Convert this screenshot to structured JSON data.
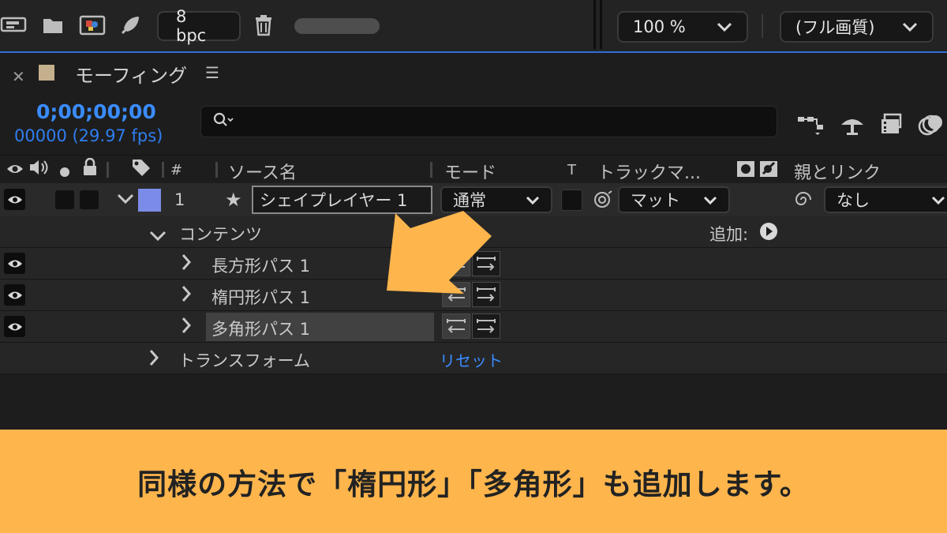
{
  "toolbar": {
    "bpc_label": "8 bpc",
    "zoom_label": "100 %",
    "quality_label": "(フル画質)"
  },
  "panel": {
    "title": "モーフィング",
    "timecode": "0;00;00;00",
    "frames": "00000 (29.97 fps)",
    "search_placeholder": "",
    "search_icon_glyph": "⚲"
  },
  "columns": {
    "hash": "#",
    "source_name": "ソース名",
    "mode": "モード",
    "t": "T",
    "track_matte": "トラックマ...",
    "parent": "親とリンク"
  },
  "layer": {
    "number": "1",
    "name": "シェイプレイヤー 1",
    "mode": "通常",
    "matte": "マット",
    "parent": "なし",
    "label_color": "#7b8ce8"
  },
  "contents": {
    "label": "コンテンツ",
    "add_label": "追加:",
    "paths": [
      {
        "name": "長方形パス 1"
      },
      {
        "name": "楕円形パス 1"
      },
      {
        "name": "多角形パス 1"
      }
    ]
  },
  "transform": {
    "label": "トランスフォーム",
    "reset_label": "リセット"
  },
  "caption": {
    "text": "同様の方法で「楕円形」「多角形」も追加します。"
  },
  "colors": {
    "accent_blue": "#3a8cff",
    "arrow": "#fdb54c",
    "caption_bg": "#fdb54c"
  }
}
